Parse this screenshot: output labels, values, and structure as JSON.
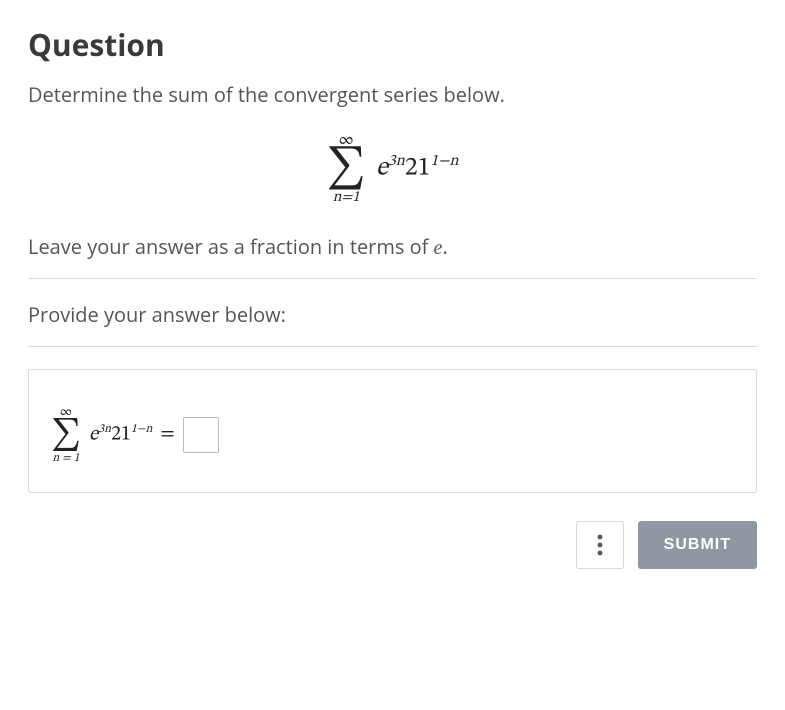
{
  "title": "Question",
  "prompt": "Determine the sum of the convergent series below.",
  "series": {
    "upper": "∞",
    "lower": "n=1",
    "base1": "e",
    "exp1": "3n",
    "base2": "21",
    "exp2": "1−n"
  },
  "instruction_prefix": "Leave your answer as a fraction in terms of ",
  "instruction_var": "e",
  "instruction_suffix": ".",
  "answer_heading": "Provide your answer below:",
  "answer_series": {
    "upper": "∞",
    "lower": "n = 1",
    "base1": "e",
    "exp1": "3n",
    "base2": "21",
    "exp2": "1−n",
    "equals": "="
  },
  "buttons": {
    "submit": "SUBMIT"
  }
}
